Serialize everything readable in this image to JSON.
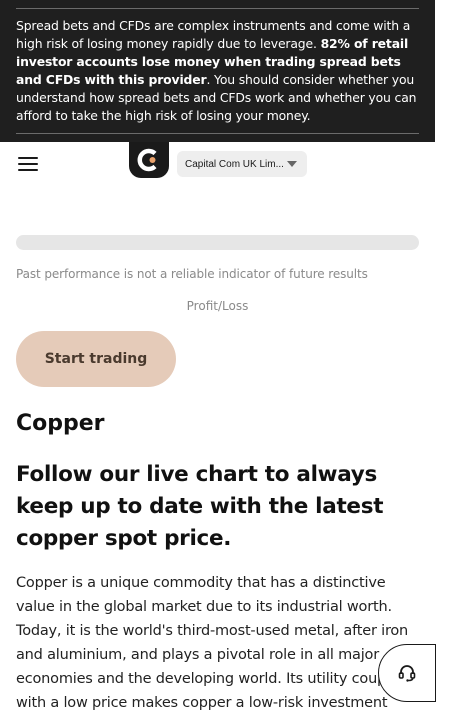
{
  "risk_warning": {
    "text_before": "Spread bets and CFDs are complex instruments and come with a high risk of losing money rapidly due to leverage. ",
    "text_bold": "82% of retail investor accounts lose money when trading spread bets and CFDs with this provider",
    "text_after": ". You should consider whether you understand how spread bets and CFDs work and whether you can afford to take the high risk of losing your money."
  },
  "header": {
    "menu_icon": "hamburger-menu-icon",
    "logo_icon": "capital-com-logo-icon",
    "entity_selector": "Capital Com UK Lim..."
  },
  "chart": {
    "disclaimer": "Past performance is not a reliable indicator of future results",
    "profit_loss_label": "Profit/Loss"
  },
  "cta": {
    "start_trading": "Start trading"
  },
  "content": {
    "title": "Copper",
    "headline": "Follow our live chart to always keep up to date with the latest copper spot price.",
    "body": "Copper is a unique commodity that has a distinctive value in the global market due to its industrial worth. Today, it is the world's third-most-used metal, after iron and aluminium, and plays a pivotal role in all major economies and the developing world. Its utility coupled with a low price makes copper a low-risk investment"
  },
  "support": {
    "icon": "headset-support-icon"
  },
  "colors": {
    "banner_bg": "#1f1f1f",
    "cta_bg": "#e5cbb9",
    "accent_orange": "#e8a06a"
  }
}
